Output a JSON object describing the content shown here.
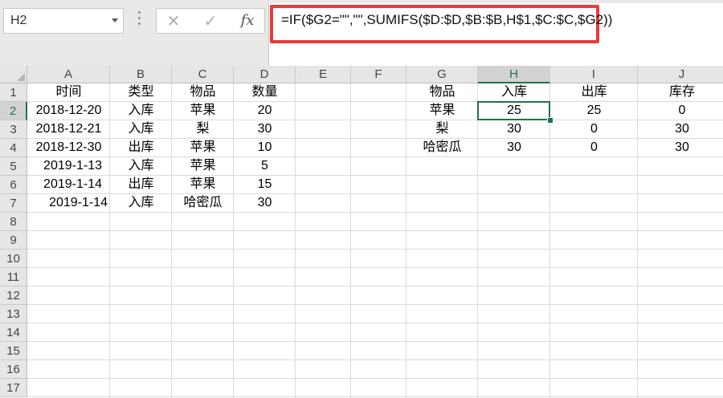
{
  "name_box": {
    "value": "H2"
  },
  "formula_bar": {
    "cancel_glyph": "✕",
    "enter_glyph": "✓",
    "fx_label": "fx",
    "formula": "=IF($G2=\"\",\"\",SUMIFS($D:$D,$B:$B,H$1,$C:$C,$G2))"
  },
  "accent_color": "#217346",
  "highlight_color": "#e93a3a",
  "columns": [
    "A",
    "B",
    "C",
    "D",
    "E",
    "F",
    "G",
    "H",
    "I",
    "J"
  ],
  "rows": [
    "1",
    "2",
    "3",
    "4",
    "5",
    "6",
    "7",
    "8",
    "9",
    "10",
    "11",
    "12",
    "13",
    "14",
    "15",
    "16",
    "17"
  ],
  "selected_cell": "H2",
  "cells": {
    "A1": "时间",
    "B1": "类型",
    "C1": "物品",
    "D1": "数量",
    "A2": "2018-12-20",
    "B2": "入库",
    "C2": "苹果",
    "D2": "20",
    "A3": "2018-12-21",
    "B3": "入库",
    "C3": "梨",
    "D3": "30",
    "A4": "2018-12-30",
    "B4": "出库",
    "C4": "苹果",
    "D4": "10",
    "A5": "2019-1-13",
    "B5": "入库",
    "C5": "苹果",
    "D5": "5",
    "A6": "2019-1-14",
    "B6": "出库",
    "C6": "苹果",
    "D6": "15",
    "A7": "2019-1-14",
    "B7": "入库",
    "C7": "哈密瓜",
    "D7": "30",
    "G1": "物品",
    "H1": "入库",
    "I1": "出库",
    "J1": "库存",
    "G2": "苹果",
    "H2": "25",
    "I2": "25",
    "J2": "0",
    "G3": "梨",
    "H3": "30",
    "I3": "0",
    "J3": "30",
    "G4": "哈密瓜",
    "H4": "30",
    "I4": "0",
    "J4": "30"
  }
}
